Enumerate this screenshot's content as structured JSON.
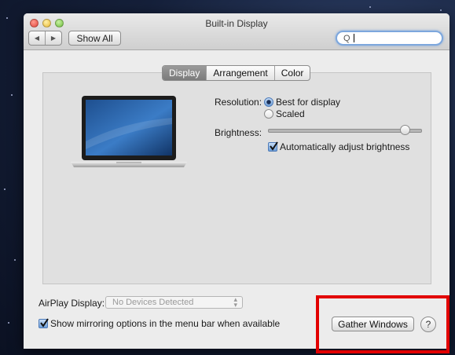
{
  "window": {
    "title": "Built-in Display"
  },
  "toolbar": {
    "back_icon": "◀",
    "forward_icon": "▶",
    "show_all_label": "Show All",
    "search_value": "",
    "search_icon": "Q"
  },
  "tabs": [
    {
      "label": "Display",
      "selected": true
    },
    {
      "label": "Arrangement",
      "selected": false
    },
    {
      "label": "Color",
      "selected": false
    }
  ],
  "display": {
    "resolution_label": "Resolution:",
    "resolution_options": [
      {
        "label": "Best for display",
        "selected": true
      },
      {
        "label": "Scaled",
        "selected": false
      }
    ],
    "brightness_label": "Brightness:",
    "brightness_level": 0.9,
    "auto_brightness_label": "Automatically adjust brightness",
    "auto_brightness_checked": true
  },
  "airplay": {
    "label": "AirPlay Display:",
    "selected_value": "No Devices Detected",
    "enabled": false
  },
  "mirroring": {
    "label": "Show mirroring options in the menu bar when available",
    "checked": true
  },
  "buttons": {
    "gather_windows": "Gather Windows",
    "help": "?"
  },
  "annotation": {
    "color": "#e20000"
  }
}
